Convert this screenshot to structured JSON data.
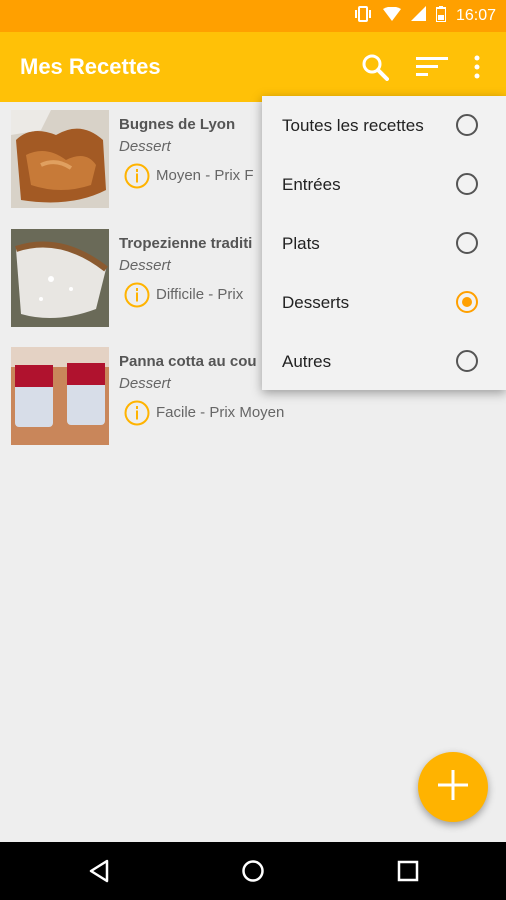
{
  "status_bar": {
    "time": "16:07"
  },
  "app_bar": {
    "title": "Mes Recettes",
    "icons": [
      "search-icon",
      "sort-icon",
      "more-vert-icon"
    ]
  },
  "recipes": [
    {
      "title": "Bugnes de Lyon",
      "category": "Dessert",
      "meta": "Moyen - Prix F"
    },
    {
      "title": "Tropezienne traditi",
      "category": "Dessert",
      "meta": "Difficile - Prix"
    },
    {
      "title": "Panna cotta au cou",
      "category": "Dessert",
      "meta": "Facile - Prix Moyen"
    }
  ],
  "filter_menu": {
    "items": [
      {
        "label": "Toutes les recettes",
        "selected": false
      },
      {
        "label": "Entrées",
        "selected": false
      },
      {
        "label": "Plats",
        "selected": false
      },
      {
        "label": "Desserts",
        "selected": true
      },
      {
        "label": "Autres",
        "selected": false
      }
    ]
  },
  "fab": {
    "icon": "plus-icon"
  },
  "nav_bar": {
    "icons": [
      "back-icon",
      "home-icon",
      "recents-icon"
    ]
  },
  "colors": {
    "primary": "#ffc107",
    "primary_dark": "#ffa000",
    "accent": "#ffb300",
    "background": "#eeeeee"
  }
}
